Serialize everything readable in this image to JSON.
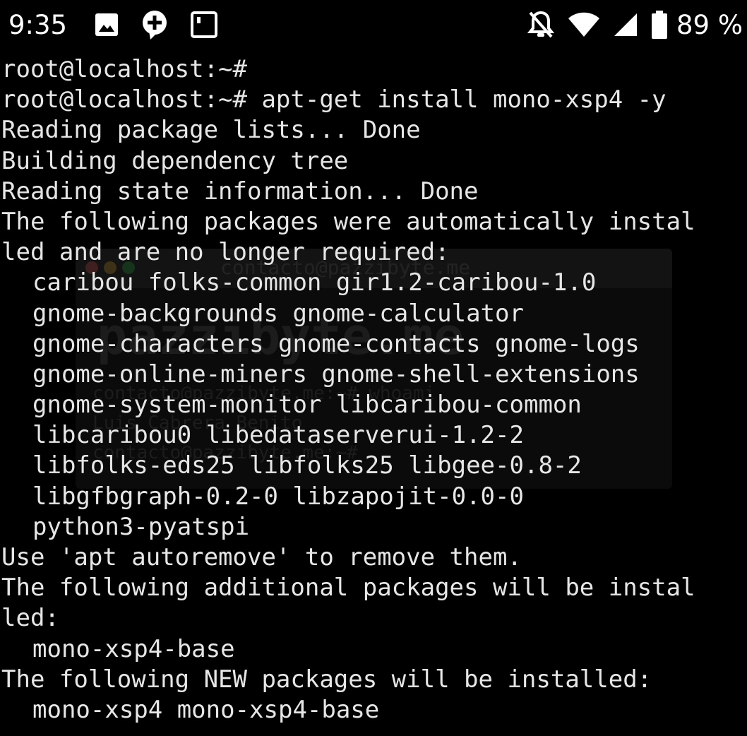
{
  "status_bar": {
    "time": "9:35",
    "left_icons": [
      "image-icon",
      "chat-plus-icon",
      "screen-icon"
    ],
    "right_icons": [
      "notifications-off-icon",
      "wifi-icon",
      "cell-signal-icon",
      "battery-icon"
    ],
    "battery_percent": "89 %"
  },
  "watermark": {
    "line1": "contacto@pazzibyte.me",
    "line2": "pazzibyte.me",
    "line3": "contacto@pazzibyte.me:~# whoami",
    "line4": "Luis Cabrera Benito",
    "line5": "contacto@pazzibyte.me:~#"
  },
  "terminal": {
    "lines": [
      {
        "text": "root@localhost:~#",
        "indent": false
      },
      {
        "text": "root@localhost:~# apt-get install mono-xsp4 -y",
        "indent": false
      },
      {
        "text": "Reading package lists... Done",
        "indent": false
      },
      {
        "text": "Building dependency tree",
        "indent": false
      },
      {
        "text": "Reading state information... Done",
        "indent": false
      },
      {
        "text": "The following packages were automatically instal",
        "indent": false
      },
      {
        "text": "led and are no longer required:",
        "indent": false
      },
      {
        "text": "caribou folks-common gir1.2-caribou-1.0",
        "indent": true
      },
      {
        "text": "gnome-backgrounds gnome-calculator",
        "indent": true
      },
      {
        "text": "gnome-characters gnome-contacts gnome-logs",
        "indent": true
      },
      {
        "text": "gnome-online-miners gnome-shell-extensions",
        "indent": true
      },
      {
        "text": "gnome-system-monitor libcaribou-common",
        "indent": true
      },
      {
        "text": "libcaribou0 libedataserverui-1.2-2",
        "indent": true
      },
      {
        "text": "libfolks-eds25 libfolks25 libgee-0.8-2",
        "indent": true
      },
      {
        "text": "libgfbgraph-0.2-0 libzapojit-0.0-0",
        "indent": true
      },
      {
        "text": "python3-pyatspi",
        "indent": true
      },
      {
        "text": "Use 'apt autoremove' to remove them.",
        "indent": false
      },
      {
        "text": "The following additional packages will be instal",
        "indent": false
      },
      {
        "text": "led:",
        "indent": false
      },
      {
        "text": "mono-xsp4-base",
        "indent": true
      },
      {
        "text": "The following NEW packages will be installed:",
        "indent": false
      },
      {
        "text": "mono-xsp4 mono-xsp4-base",
        "indent": true
      }
    ]
  },
  "colors": {
    "background": "#000000",
    "text": "#e6e6e6",
    "status_icons": "#ffffff"
  }
}
